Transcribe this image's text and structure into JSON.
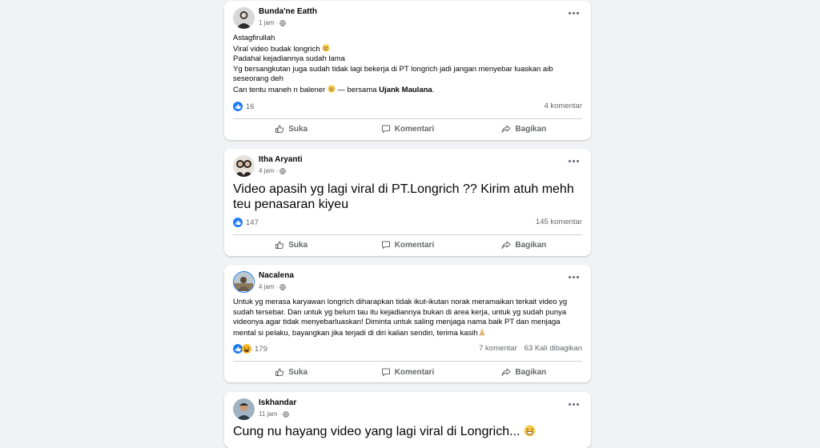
{
  "colors": {
    "background": "#f0f2f5",
    "card": "#ffffff",
    "like_blue": "#1877f2",
    "muted": "#65676b"
  },
  "actions": {
    "like": "Suka",
    "comment": "Komentari",
    "share": "Bagikan"
  },
  "posts": [
    {
      "author": "Bunda'ne Eatth",
      "time": "1 jam · ",
      "lines": [
        "Astagfirullah",
        "Viral video budak longrich",
        "Padahal kejadiannya sudah lama",
        "Yg bersangkutan juga sudah tidak lagi bekerja di PT longrich jadi jangan menyebar luaskan aib seseorang deh",
        "Can tentu maneh n balener",
        " — bersama ",
        "Ujank Maulana",
        "."
      ],
      "reactions": "16",
      "comments": "4 komentar"
    },
    {
      "author": "Itha Aryanti",
      "time": "4 jam · ",
      "text": "Video apasih yg lagi viral di PT.Longrich ?? Kirim atuh mehh teu penasaran kiyeu",
      "reactions": "147",
      "comments": "145 komentar"
    },
    {
      "author": "Nacalena",
      "time": "4 jam · ",
      "text": "Untuk yg merasa karyawan longrich diharapkan tidak ikut-ikutan norak meramaikan terkait video yg sudah tersebar. Dan untuk yg belum tau itu kejadiannya bukan di area kerja, untuk yg sudah punya videonya agar tidak menyebarluaskan! Diminta untuk saling menjaga nama baik PT dan menjaga mental si pelaku, bayangkan jika terjadi di diri kalian sendiri, terima kasih",
      "reactions": "179",
      "comments": "7 komentar",
      "shares": "63 Kali dibagikan"
    },
    {
      "author": "Iskhandar",
      "time": "11 jam · ",
      "text": "Cung nu hayang video yang lagi viral di Longrich..."
    }
  ]
}
